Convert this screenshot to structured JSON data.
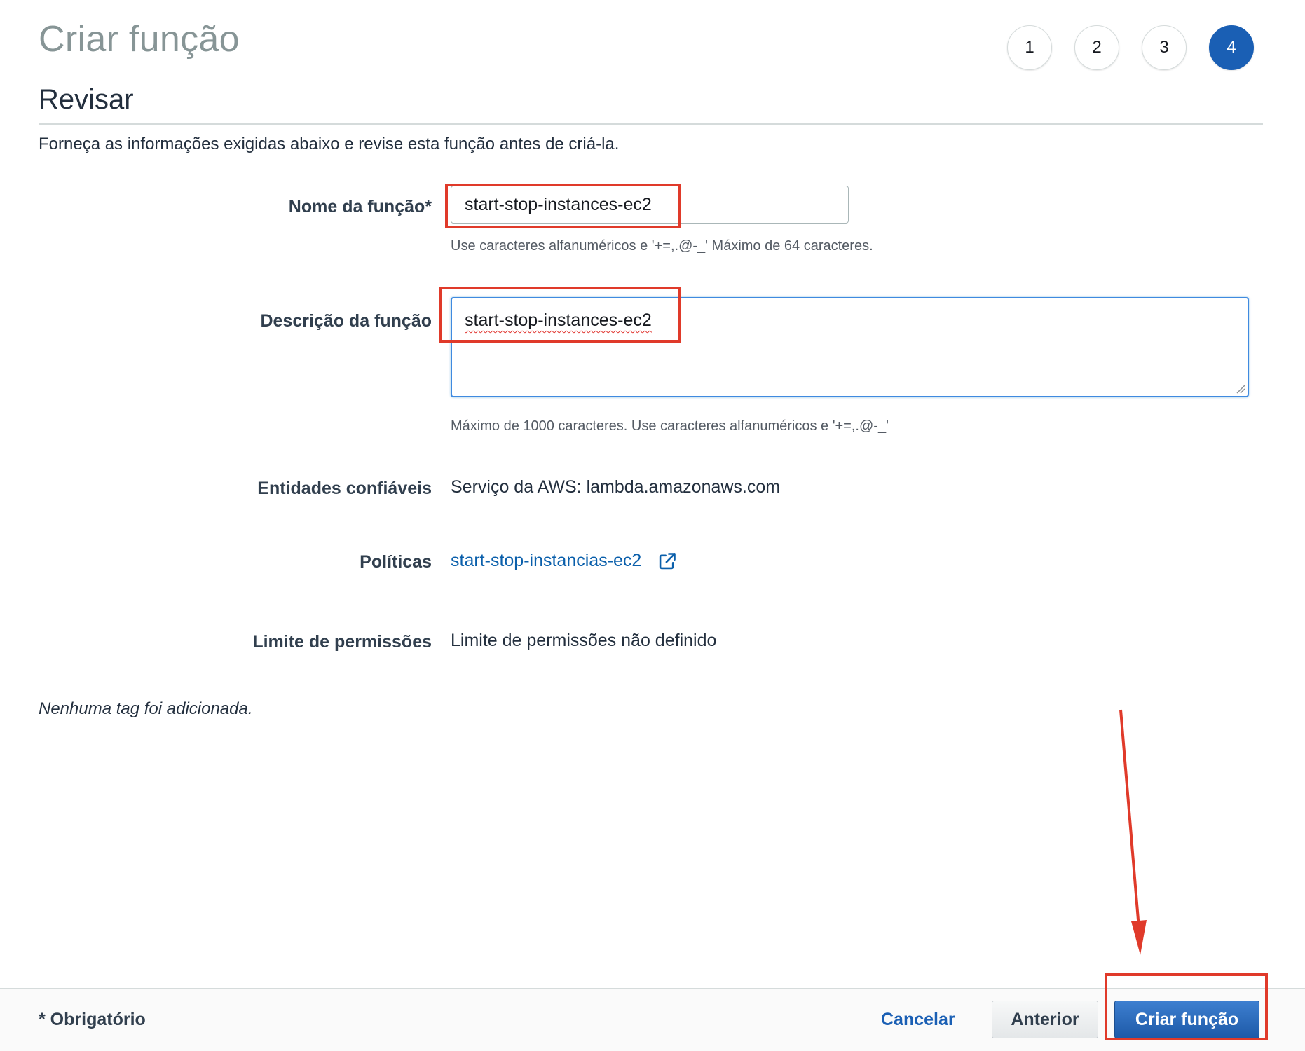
{
  "header": {
    "title": "Criar função",
    "steps": [
      "1",
      "2",
      "3",
      "4"
    ],
    "active_step": 4
  },
  "section": {
    "title": "Revisar",
    "intro": "Forneça as informações exigidas abaixo e revise esta função antes de criá-la."
  },
  "form": {
    "name": {
      "label": "Nome da função*",
      "value": "start-stop-instances-ec2",
      "hint": "Use caracteres alfanuméricos e '+=,.@-_' Máximo de 64 caracteres."
    },
    "description": {
      "label": "Descrição da função",
      "value": "start-stop-instances-ec2",
      "hint": "Máximo de 1000 caracteres. Use caracteres alfanuméricos e '+=,.@-_'"
    },
    "trusted_entities": {
      "label": "Entidades confiáveis",
      "value": "Serviço da AWS: lambda.amazonaws.com"
    },
    "policies": {
      "label": "Políticas",
      "link": "start-stop-instancias-ec2",
      "icon": "external-link-icon"
    },
    "permissions_boundary": {
      "label": "Limite de permissões",
      "value": "Limite de permissões não definido"
    }
  },
  "tags_note": "Nenhuma tag foi adicionada.",
  "footer": {
    "required_note": "* Obrigatório",
    "cancel_label": "Cancelar",
    "previous_label": "Anterior",
    "create_label": "Criar função"
  },
  "colors": {
    "primary": "#1e5aa8",
    "link": "#0a5fab",
    "annotation": "#e03a2a",
    "focus": "#3f8ae0"
  }
}
